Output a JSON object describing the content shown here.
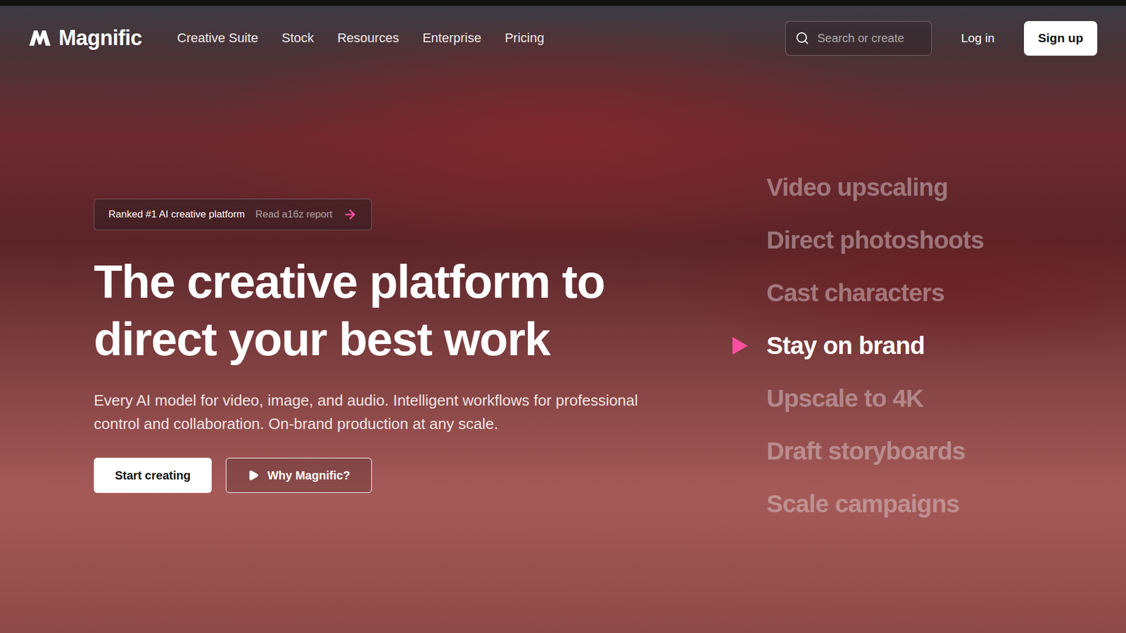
{
  "brand": {
    "name": "Magnific"
  },
  "nav": {
    "links": [
      "Creative Suite",
      "Stock",
      "Resources",
      "Enterprise",
      "Pricing"
    ]
  },
  "search": {
    "placeholder": "Search or create"
  },
  "auth": {
    "login": "Log in",
    "signup": "Sign up"
  },
  "hero": {
    "badge": {
      "label": "Ranked #1 AI creative platform",
      "link": "Read a16z report"
    },
    "headline": [
      "The creative platform to",
      "direct your best work"
    ],
    "subtitle": [
      "Every AI model for video, image, and audio. Intelligent workflows for professional",
      "control and collaboration. On-brand production at any scale."
    ],
    "buttons": {
      "primary": "Start creating",
      "secondary": "Why Magnific?"
    }
  },
  "features": [
    {
      "label": "Video upscaling",
      "selected": false
    },
    {
      "label": "Direct photoshoots",
      "selected": false
    },
    {
      "label": "Cast characters",
      "selected": false
    },
    {
      "label": "Stay on brand",
      "selected": true
    },
    {
      "label": "Upscale to 4K",
      "selected": false
    },
    {
      "label": "Draft storyboards",
      "selected": false
    },
    {
      "label": "Scale campaigns",
      "selected": false
    }
  ]
}
